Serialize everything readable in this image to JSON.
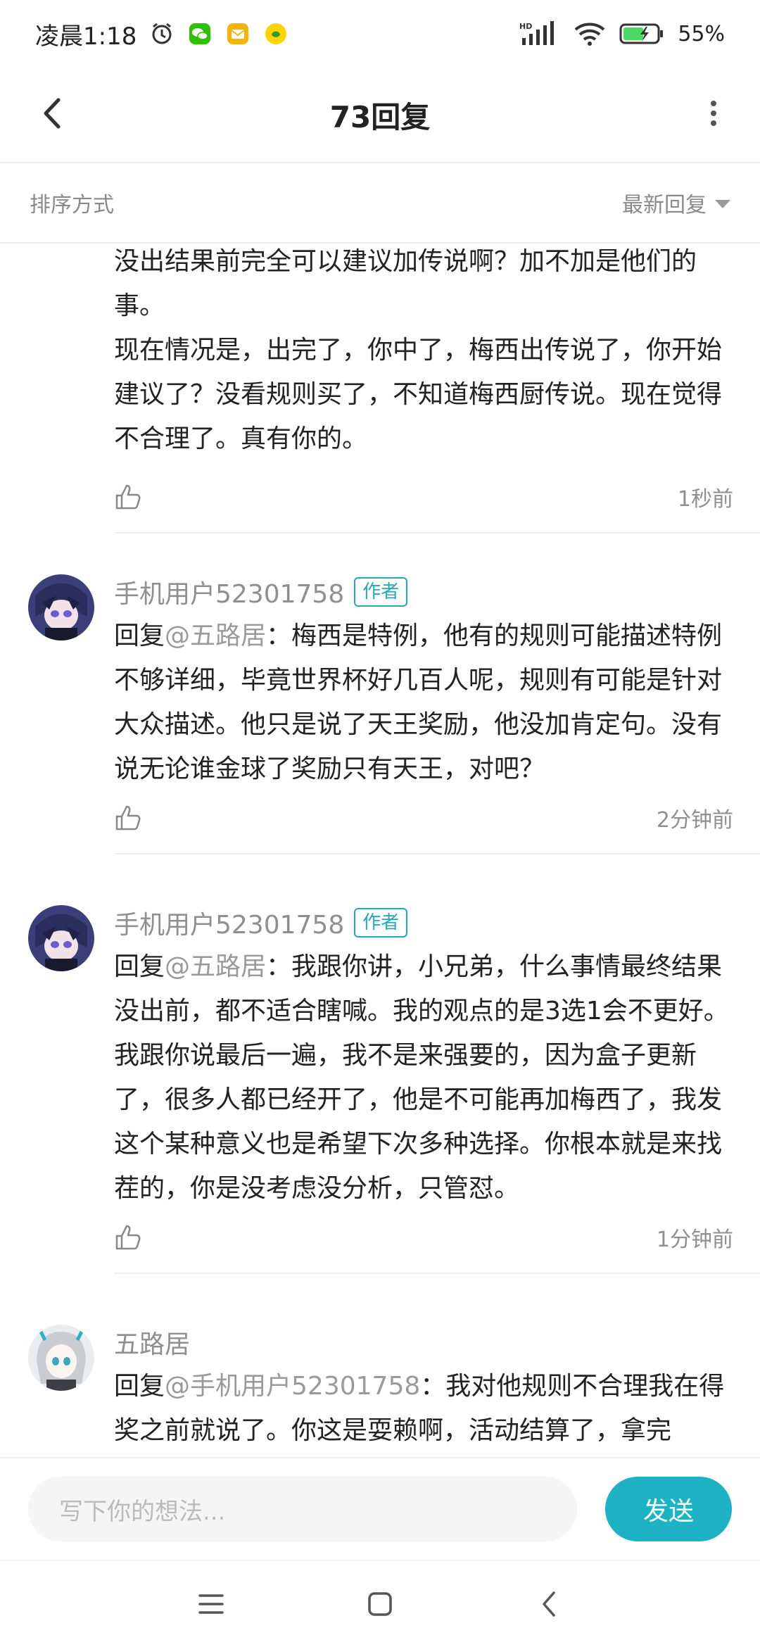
{
  "status_bar": {
    "time": "凌晨1:18",
    "battery": "55%",
    "icons_left": [
      "alarm-icon",
      "wechat-icon",
      "mail-icon",
      "app-icon"
    ],
    "icons_right": [
      "hd-signal-icon",
      "wifi-icon",
      "battery-icon"
    ]
  },
  "header": {
    "title": "73回复"
  },
  "sort": {
    "label": "排序方式",
    "selected": "最新回复"
  },
  "comments": [
    {
      "text": "没出结果前完全可以建议加传说啊？加不加是他们的事。\n现在情况是，出完了，你中了，梅西出传说了，你开始建议了？没看规则买了，不知道梅西厨传说。现在觉得不合理了。真有你的。",
      "time": "1秒前"
    },
    {
      "user": "手机用户52301758",
      "badge": "作者",
      "reply_prefix": "回复",
      "mention": "@五路居",
      "text": "：梅西是特例，他有的规则可能描述特例不够详细，毕竟世界杯好几百人呢，规则有可能是针对大众描述。他只是说了天王奖励，他没加肯定句。没有说无论谁金球了奖励只有天王，对吧？",
      "time": "2分钟前"
    },
    {
      "user": "手机用户52301758",
      "badge": "作者",
      "reply_prefix": "回复",
      "mention": "@五路居",
      "text": "：我跟你讲，小兄弟，什么事情最终结果没出前，都不适合瞎喊。我的观点的是3选1会不更好。我跟你说最后一遍，我不是来强要的，因为盒子更新了，很多人都已经开了，他是不可能再加梅西了，我发这个某种意义也是希望下次多种选择。你根本就是来找茬的，你是没考虑没分析，只管怼。",
      "time": "1分钟前"
    },
    {
      "user": "五路居",
      "reply_prefix": "回复",
      "mention": "@手机用户52301758",
      "text": "：我对他规则不合理我在得奖之前就说了。你这是耍赖啊，活动结算了，拿完"
    }
  ],
  "input": {
    "placeholder": "写下你的想法...",
    "send_label": "发送"
  },
  "colors": {
    "accent": "#1db3c4",
    "badge": "#23a9ba",
    "secondary_text": "#8f8f8f"
  }
}
